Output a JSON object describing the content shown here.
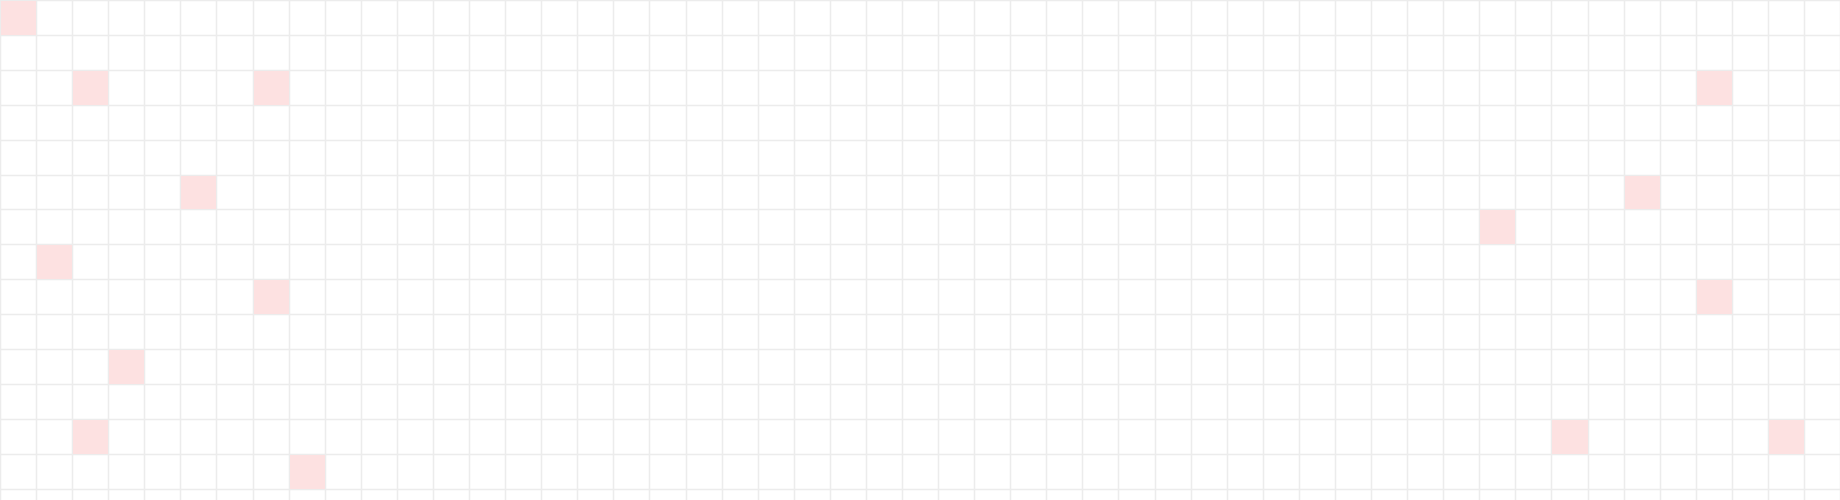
{
  "grid": {
    "columns": 51,
    "rows": 15,
    "line_color": "#ececec",
    "background_color": "#ffffff",
    "highlight_color": "#fde1e1",
    "highlighted_cells": [
      {
        "col": 0,
        "row": 0
      },
      {
        "col": 2,
        "row": 2
      },
      {
        "col": 7,
        "row": 2
      },
      {
        "col": 47,
        "row": 2
      },
      {
        "col": 5,
        "row": 5
      },
      {
        "col": 45,
        "row": 5
      },
      {
        "col": 41,
        "row": 6
      },
      {
        "col": 1,
        "row": 7
      },
      {
        "col": 7,
        "row": 8
      },
      {
        "col": 47,
        "row": 8
      },
      {
        "col": 3,
        "row": 10
      },
      {
        "col": 2,
        "row": 12
      },
      {
        "col": 43,
        "row": 12
      },
      {
        "col": 49,
        "row": 12
      },
      {
        "col": 8,
        "row": 13
      }
    ]
  }
}
